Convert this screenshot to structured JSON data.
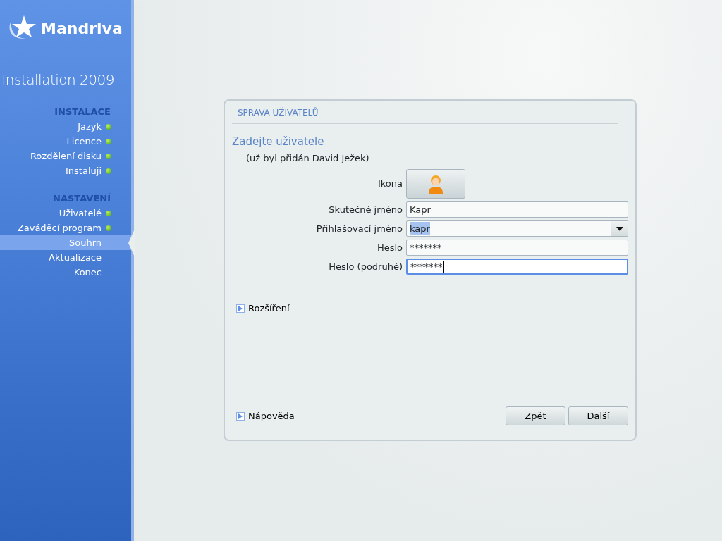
{
  "logo": {
    "brand": "Mandriva",
    "subtitle": "Installation 2009"
  },
  "sidebar": {
    "sections": [
      {
        "heading": "INSTALACE",
        "items": [
          {
            "label": "Jazyk",
            "done": true,
            "selected": false
          },
          {
            "label": "Licence",
            "done": true,
            "selected": false
          },
          {
            "label": "Rozdělení disku",
            "done": true,
            "selected": false
          },
          {
            "label": "Instaluji",
            "done": true,
            "selected": false
          }
        ]
      },
      {
        "heading": "NASTAVENÍ",
        "items": [
          {
            "label": "Uživatelé",
            "done": true,
            "selected": false
          },
          {
            "label": "Zaváděcí program",
            "done": true,
            "selected": false
          },
          {
            "label": "Souhrn",
            "done": false,
            "selected": true
          },
          {
            "label": "Aktualizace",
            "done": false,
            "selected": false
          },
          {
            "label": "Konec",
            "done": false,
            "selected": false
          }
        ]
      }
    ]
  },
  "dialog": {
    "title": "SPRÁVA UŽIVATELŮ",
    "heading": "Zadejte uživatele",
    "note": "(už byl přidán David Ježek)",
    "fields": [
      {
        "kind": "icon",
        "label": "Ikona"
      },
      {
        "kind": "text",
        "label": "Skutečné jméno",
        "value": "Kapr",
        "focused": false
      },
      {
        "kind": "combo",
        "label": "Přihlašovací jméno",
        "value": "kapr",
        "text_selected": true,
        "focused": false
      },
      {
        "kind": "text",
        "label": "Heslo",
        "value": "*******",
        "focused": false
      },
      {
        "kind": "text",
        "label": "Heslo (podruhé)",
        "value": "*******",
        "focused": true
      }
    ],
    "advanced": {
      "label": "Rozšíření",
      "expanded": false
    },
    "help": {
      "label": "Nápověda",
      "expanded": false
    },
    "buttons": [
      "Zpět",
      "Další"
    ]
  }
}
